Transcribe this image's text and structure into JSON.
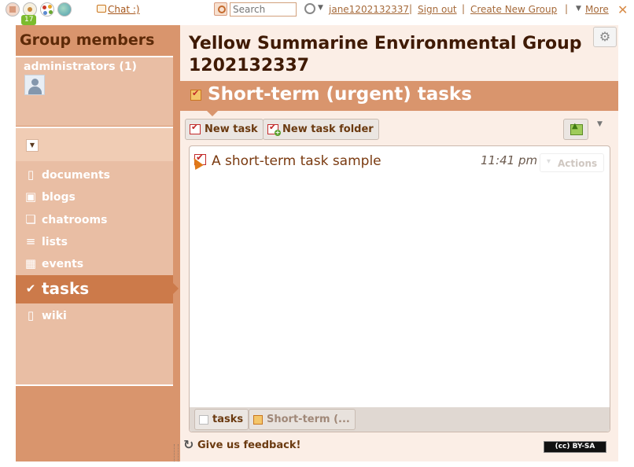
{
  "topbar": {
    "badge_count": "17",
    "chat_label": "Chat :)",
    "search_placeholder": "Search",
    "username": "jane1202132337",
    "sign_out": "Sign out",
    "create_group": "Create New Group",
    "more": "More",
    "separator": "|"
  },
  "sidebar": {
    "title": "Group members",
    "members_heading": "administrators (1)",
    "items": [
      {
        "label": "documents",
        "icon": "document-icon"
      },
      {
        "label": "blogs",
        "icon": "blog-icon"
      },
      {
        "label": "chatrooms",
        "icon": "chat-icon"
      },
      {
        "label": "lists",
        "icon": "list-icon"
      },
      {
        "label": "events",
        "icon": "calendar-icon"
      },
      {
        "label": "tasks",
        "icon": "check-icon",
        "active": true
      },
      {
        "label": "wiki",
        "icon": "wiki-icon"
      }
    ]
  },
  "main": {
    "title": "Yellow Summarine Environmental Group 1202132337",
    "section_title": "Short-term (urgent) tasks",
    "new_task_label": "New task",
    "new_folder_label": "New task folder",
    "tasks": [
      {
        "title": "A short-term task sample",
        "time": "11:41 pm",
        "actions_label": "Actions"
      }
    ],
    "breadcrumbs": [
      "tasks",
      "Short-term (..."
    ],
    "feedback_label": "Give us feedback!",
    "license_label": "(cc) BY-SA"
  },
  "colors": {
    "accent": "#d9956d",
    "sidebar_light": "#e9bea4",
    "active_item": "#cc7a4a",
    "panel_bg": "#fbeee6",
    "heading_text": "#3f1a04"
  }
}
